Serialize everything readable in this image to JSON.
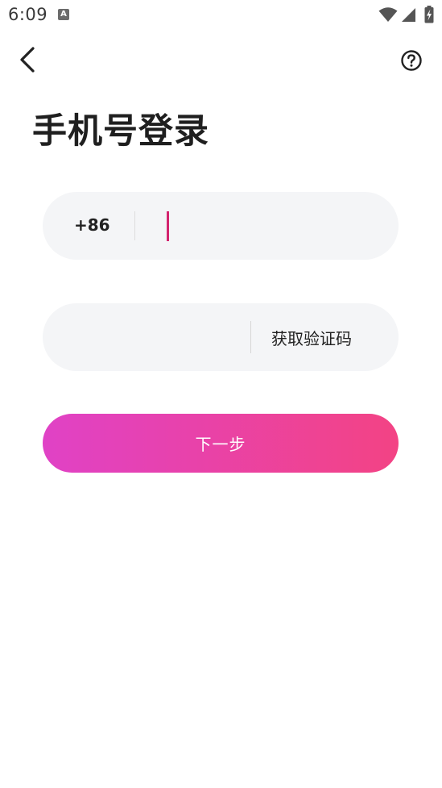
{
  "status_bar": {
    "time": "6:09",
    "notification_icon": "a-letter-icon",
    "notification_glyph": "A",
    "icons": [
      "wifi-icon",
      "signal-icon",
      "battery-charging-icon"
    ]
  },
  "header": {
    "back_icon": "chevron-left-icon",
    "help_icon": "question-circle-icon"
  },
  "page": {
    "title": "手机号登录"
  },
  "phone_field": {
    "country_code": "+86",
    "value": "",
    "placeholder": ""
  },
  "code_field": {
    "value": "",
    "placeholder": "",
    "get_code_label": "获取验证码"
  },
  "next_button": {
    "label": "下一步"
  },
  "colors": {
    "accent_start": "#e042c6",
    "accent_end": "#f34384",
    "caret": "#d3246e",
    "field_bg": "#f4f5f7"
  }
}
